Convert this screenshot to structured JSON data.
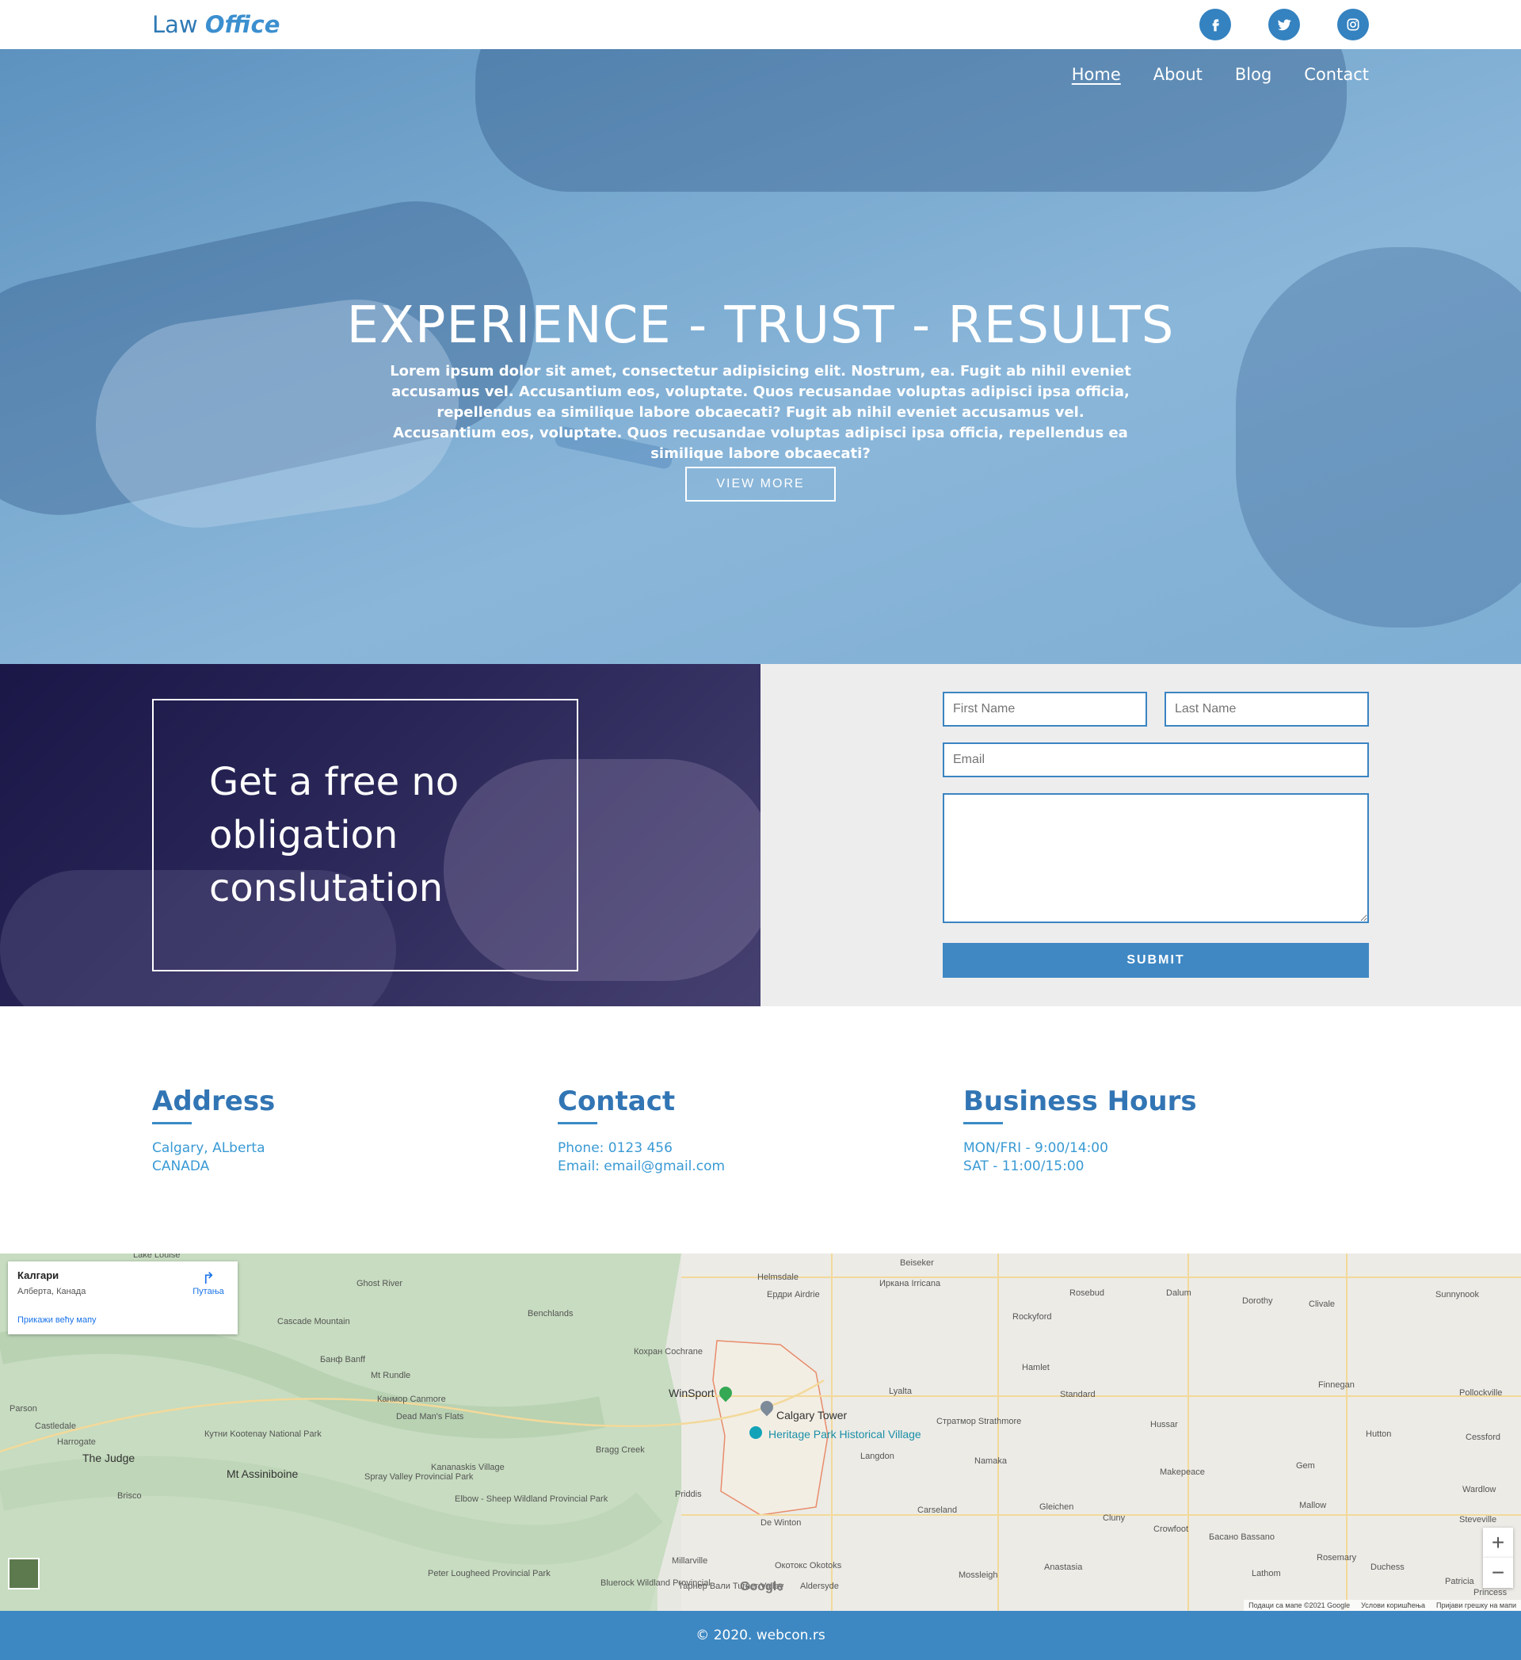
{
  "header": {
    "logo_light": "Law",
    "logo_bold": "Office",
    "social": [
      "facebook-icon",
      "twitter-icon",
      "instagram-icon"
    ]
  },
  "nav": {
    "items": [
      "Home",
      "About",
      "Blog",
      "Contact"
    ],
    "active": "Home"
  },
  "hero": {
    "title": "EXPERIENCE - TRUST - RESULTS",
    "text": "Lorem ipsum dolor sit amet, consectetur adipisicing elit. Nostrum, ea. Fugit ab nihil eveniet accusamus vel. Accusantium eos, voluptate. Quos recusandae voluptas adipisci ipsa officia, repellendus ea similique labore obcaecati? Fugit ab nihil eveniet accusamus vel. Accusantium eos, voluptate. Quos recusandae voluptas adipisci ipsa officia, repellendus ea similique labore obcaecati?",
    "button": "VIEW MORE"
  },
  "consult": {
    "heading": "Get a free no obligation conslutation"
  },
  "form": {
    "first_name_placeholder": "First Name",
    "last_name_placeholder": "Last Name",
    "email_placeholder": "Email",
    "message_value": "",
    "submit": "SUBMIT"
  },
  "info": {
    "address": {
      "title": "Address",
      "line1": "Calgary, ALberta",
      "line2": "CANADA"
    },
    "contact": {
      "title": "Contact",
      "line1": "Phone: 0123 456",
      "line2": "Email: email@gmail.com"
    },
    "hours": {
      "title": "Business Hours",
      "line1": "MON/FRI - 9:00/14:00",
      "line2": "SAT - 11:00/15:00"
    }
  },
  "map": {
    "card_title": "Калгари",
    "card_subtitle": "Алберта, Канада",
    "card_link": "Прикажи већу мапу",
    "directions": "Путања",
    "places": [
      "Ghost River",
      "Benchlands",
      "Cascade Mountain",
      "Банф Banff",
      "Mt Rundle",
      "Канмор Canmore",
      "Dead Man's Flats",
      "Parson",
      "Castledale",
      "Harrogate",
      "The Judge",
      "Кутни Kootenay National Park",
      "Mt Assiniboine",
      "Brisco",
      "Spray Valley Provincial Park",
      "Kananaskis Village",
      "Elbow - Sheep Wildland Provincial Park",
      "Bragg Creek",
      "Кохран Cochrane",
      "WinSport",
      "Calgary Tower",
      "Heritage Park Historical Village",
      "Priddis",
      "De Winton",
      "Millarville",
      "Окотокс Okotoks",
      "Тарнер Вали Turner Valley",
      "Aldersyde",
      "Bluerock Wildland Provincial",
      "Peter Lougheed Provincial Park",
      "Helmsdale",
      "Ердри Airdrie",
      "Иркана Irricana",
      "Beiseker",
      "Rockyford",
      "Rosebud",
      "Dalum",
      "Dorothy",
      "Clivale",
      "Sunnynook",
      "Hamlet",
      "Lyalta",
      "Standard",
      "Стратмор Strathmore",
      "Hussar",
      "Finnegan",
      "Pollockville",
      "Hutton",
      "Cessford",
      "Namaka",
      "Langdon",
      "Gem",
      "Makepeace",
      "Carseland",
      "Gleichen",
      "Cluny",
      "Crowfoot",
      "Басано Bassano",
      "Mallow",
      "Wardlow",
      "Steveville",
      "Rosemary",
      "Duchess",
      "Patricia",
      "Lathom",
      "Anastasia",
      "Mossleigh",
      "Princess",
      "Lake Louise"
    ],
    "attribution": "Подаци са мапе ©2021 Google",
    "terms": "Услови коришћења",
    "report": "Пријави грешку на мапи",
    "google": "Google"
  },
  "footer": {
    "text": "© 2020. webcon.rs"
  },
  "colors": {
    "primary": "#3d88c3",
    "hero_overlay": "#7aaad0",
    "consult_overlay": "#1a1747",
    "form_bg": "#ededed"
  }
}
